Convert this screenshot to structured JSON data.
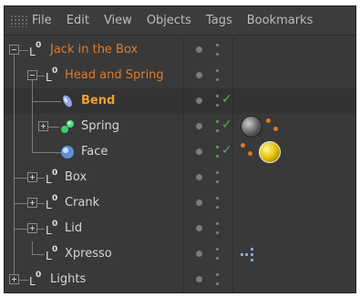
{
  "menu": [
    "File",
    "Edit",
    "View",
    "Objects",
    "Tags",
    "Bookmarks"
  ],
  "objects": [
    {
      "label": "Jack in  the Box",
      "icon": "null-icon",
      "color": "#e07b2b"
    },
    {
      "label": "Head and Spring",
      "icon": "null-icon",
      "color": "#e07b2b"
    },
    {
      "label": "Bend",
      "icon": "bend-deformer-icon",
      "color": "#f0a030",
      "check": "✓"
    },
    {
      "label": "Spring",
      "icon": "spring-spline-icon",
      "color": "#d6d6d6",
      "check": "✓"
    },
    {
      "label": "Face",
      "icon": "sphere-object-icon",
      "color": "#d6d6d6",
      "check": "✓"
    },
    {
      "label": "Box",
      "icon": "null-icon",
      "color": "#d6d6d6"
    },
    {
      "label": "Crank",
      "icon": "null-icon",
      "color": "#d6d6d6"
    },
    {
      "label": "Lid",
      "icon": "null-icon",
      "color": "#d6d6d6"
    },
    {
      "label": "Xpresso",
      "icon": "null-icon",
      "color": "#d6d6d6"
    },
    {
      "label": "Lights",
      "icon": "null-icon",
      "color": "#d6d6d6"
    }
  ],
  "null_icon": {
    "letter": "L",
    "digit": "0"
  }
}
